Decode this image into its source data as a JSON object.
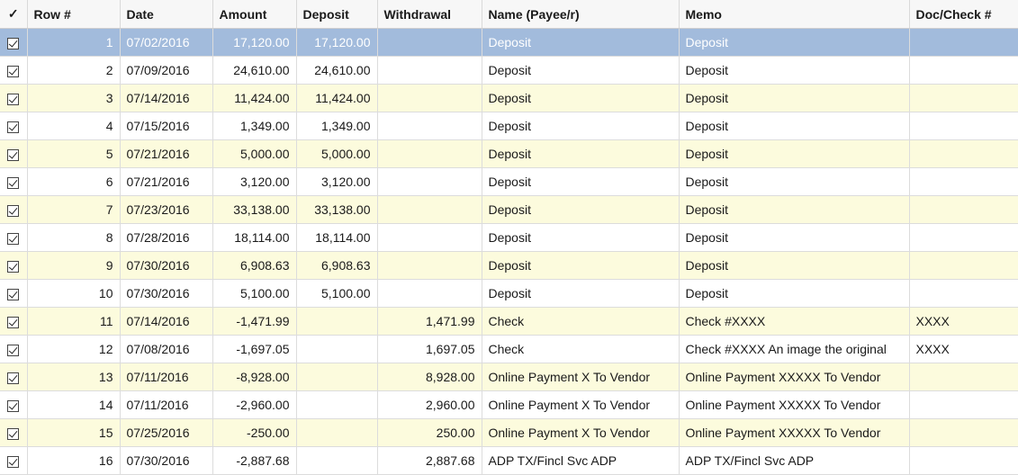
{
  "columns": {
    "check": "✓",
    "row": "Row #",
    "date": "Date",
    "amount": "Amount",
    "deposit": "Deposit",
    "withdrawal": "Withdrawal",
    "name": "Name (Payee/r)",
    "memo": "Memo",
    "doc": "Doc/Check #"
  },
  "rows": [
    {
      "checked": true,
      "row": "1",
      "date": "07/02/2016",
      "amount": "17,120.00",
      "deposit": "17,120.00",
      "withdrawal": "",
      "name": "Deposit",
      "memo": "Deposit",
      "doc": ""
    },
    {
      "checked": true,
      "row": "2",
      "date": "07/09/2016",
      "amount": "24,610.00",
      "deposit": "24,610.00",
      "withdrawal": "",
      "name": "Deposit",
      "memo": "Deposit",
      "doc": ""
    },
    {
      "checked": true,
      "row": "3",
      "date": "07/14/2016",
      "amount": "11,424.00",
      "deposit": "11,424.00",
      "withdrawal": "",
      "name": "Deposit",
      "memo": "Deposit",
      "doc": ""
    },
    {
      "checked": true,
      "row": "4",
      "date": "07/15/2016",
      "amount": "1,349.00",
      "deposit": "1,349.00",
      "withdrawal": "",
      "name": "Deposit",
      "memo": "Deposit",
      "doc": ""
    },
    {
      "checked": true,
      "row": "5",
      "date": "07/21/2016",
      "amount": "5,000.00",
      "deposit": "5,000.00",
      "withdrawal": "",
      "name": "Deposit",
      "memo": "Deposit",
      "doc": ""
    },
    {
      "checked": true,
      "row": "6",
      "date": "07/21/2016",
      "amount": "3,120.00",
      "deposit": "3,120.00",
      "withdrawal": "",
      "name": "Deposit",
      "memo": "Deposit",
      "doc": ""
    },
    {
      "checked": true,
      "row": "7",
      "date": "07/23/2016",
      "amount": "33,138.00",
      "deposit": "33,138.00",
      "withdrawal": "",
      "name": "Deposit",
      "memo": "Deposit",
      "doc": ""
    },
    {
      "checked": true,
      "row": "8",
      "date": "07/28/2016",
      "amount": "18,114.00",
      "deposit": "18,114.00",
      "withdrawal": "",
      "name": "Deposit",
      "memo": "Deposit",
      "doc": ""
    },
    {
      "checked": true,
      "row": "9",
      "date": "07/30/2016",
      "amount": "6,908.63",
      "deposit": "6,908.63",
      "withdrawal": "",
      "name": "Deposit",
      "memo": "Deposit",
      "doc": ""
    },
    {
      "checked": true,
      "row": "10",
      "date": "07/30/2016",
      "amount": "5,100.00",
      "deposit": "5,100.00",
      "withdrawal": "",
      "name": "Deposit",
      "memo": "Deposit",
      "doc": ""
    },
    {
      "checked": true,
      "row": "11",
      "date": "07/14/2016",
      "amount": "-1,471.99",
      "deposit": "",
      "withdrawal": "1,471.99",
      "name": "Check",
      "memo": "Check #XXXX",
      "doc": "XXXX"
    },
    {
      "checked": true,
      "row": "12",
      "date": "07/08/2016",
      "amount": "-1,697.05",
      "deposit": "",
      "withdrawal": "1,697.05",
      "name": "Check",
      "memo": "Check #XXXX An image the original",
      "doc": "XXXX"
    },
    {
      "checked": true,
      "row": "13",
      "date": "07/11/2016",
      "amount": "-8,928.00",
      "deposit": "",
      "withdrawal": "8,928.00",
      "name": "Online Payment X To Vendor",
      "memo": "Online Payment XXXXX To Vendor",
      "doc": ""
    },
    {
      "checked": true,
      "row": "14",
      "date": "07/11/2016",
      "amount": "-2,960.00",
      "deposit": "",
      "withdrawal": "2,960.00",
      "name": "Online Payment X To Vendor",
      "memo": "Online Payment XXXXX To Vendor",
      "doc": ""
    },
    {
      "checked": true,
      "row": "15",
      "date": "07/25/2016",
      "amount": "-250.00",
      "deposit": "",
      "withdrawal": "250.00",
      "name": "Online Payment X To Vendor",
      "memo": "Online Payment XXXXX To Vendor",
      "doc": ""
    },
    {
      "checked": true,
      "row": "16",
      "date": "07/30/2016",
      "amount": "-2,887.68",
      "deposit": "",
      "withdrawal": "2,887.68",
      "name": "ADP TX/Fincl Svc ADP",
      "memo": "ADP TX/Fincl Svc ADP",
      "doc": ""
    }
  ],
  "selected_row": "1",
  "colors": {
    "selected_row_bg": "#a2bbdc",
    "alt_row_bg": "#fcfbdd",
    "header_bg": "#f7f7f7"
  }
}
